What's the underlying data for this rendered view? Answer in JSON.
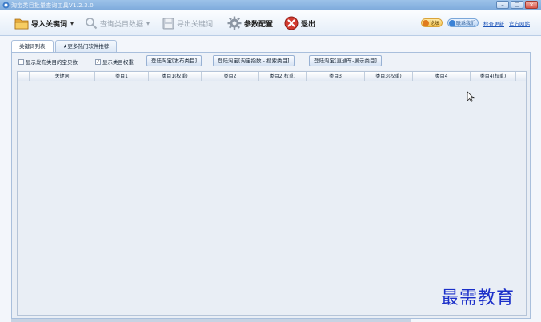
{
  "window": {
    "title": "淘宝类目批量查询工具V1.2.3.0"
  },
  "toolbar": {
    "import_keywords": "导入关键词",
    "query_category": "查询类目数据",
    "export_keywords": "导出关键词",
    "param_config": "参数配置",
    "exit": "退出",
    "dropdown_glyph": "▾",
    "badge_forum": "论坛",
    "badge_contact": "联系我们",
    "check_update": "检查更新",
    "official_site": "官方网站"
  },
  "tabs": [
    {
      "label": "关键词列表",
      "active": true
    },
    {
      "label": "★更多热门软件推荐",
      "active": false
    }
  ],
  "filters": {
    "show_publish_count": {
      "label": "显示发布类目的宝贝数",
      "checked": false
    },
    "show_category_weight": {
      "label": "显示类目权重",
      "checked": true
    },
    "login_publish": "登陆淘宝[发布类目]",
    "login_index": "登陆淘宝[淘宝指数 - 搜索类目]",
    "login_ztc": "登陆淘宝[直通车-展示类目]"
  },
  "grid": {
    "columns": [
      "关键词",
      "类目1",
      "类目1(权重)",
      "类目2",
      "类目2(权重)",
      "类目3",
      "类目3(权重)",
      "类目4",
      "类目4(权重)"
    ]
  },
  "watermark": {
    "text": "最需教育"
  },
  "colors": {
    "accent": "#7fabdc",
    "watermark": "#1b2fc9",
    "exit_red": "#d23a2f"
  }
}
